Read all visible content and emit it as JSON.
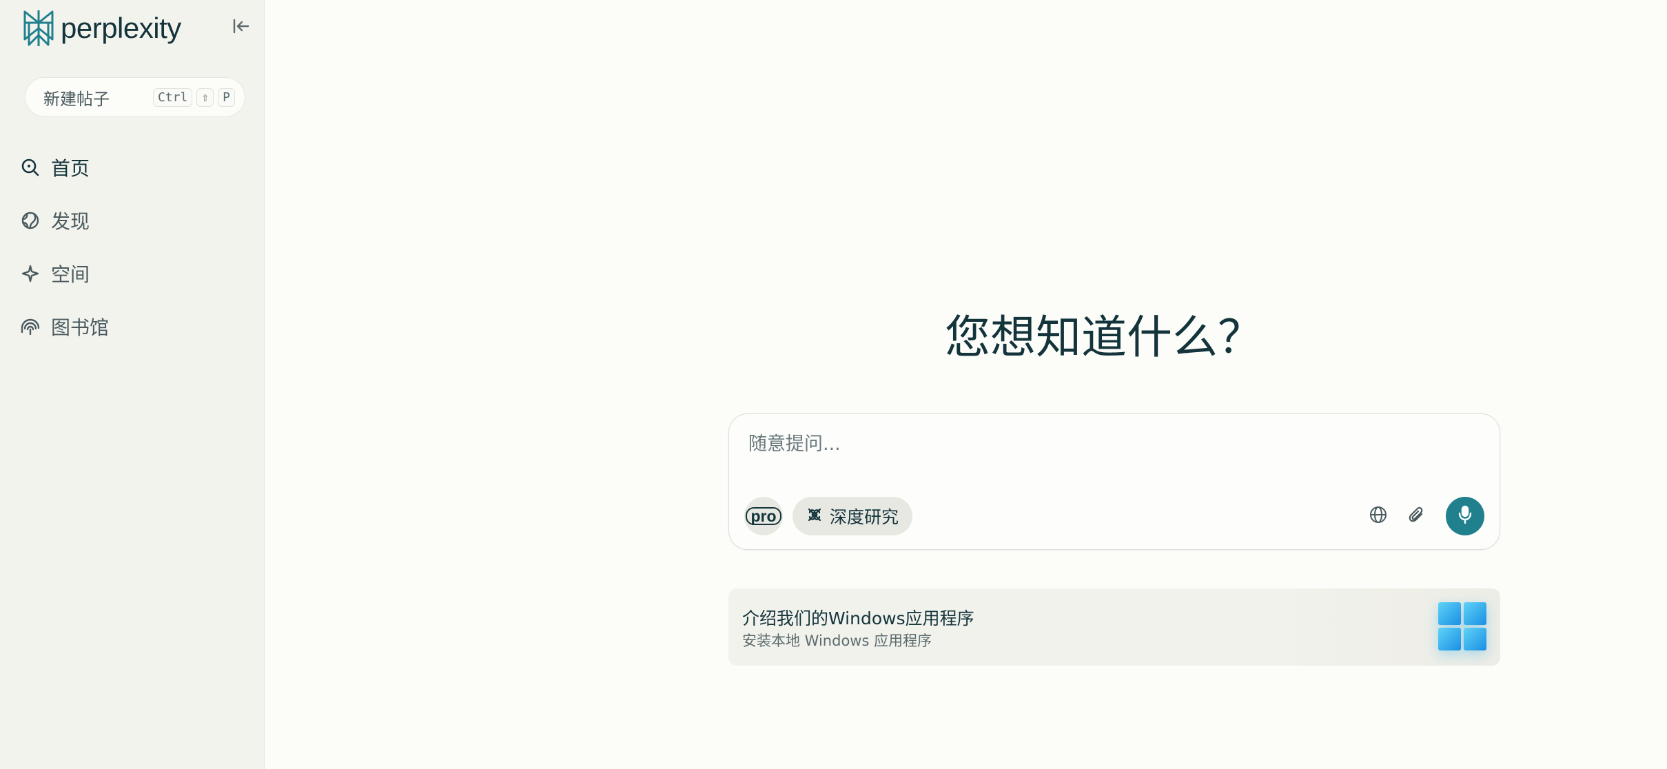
{
  "brand": {
    "name": "perplexity",
    "accent": "#20808d",
    "ink": "#13343b"
  },
  "sidebar": {
    "new_thread": {
      "label": "新建帖子",
      "shortcut": [
        "Ctrl",
        "⇧",
        "P"
      ]
    },
    "items": [
      {
        "label": "首页",
        "icon": "search-icon"
      },
      {
        "label": "发现",
        "icon": "globe-discover-icon"
      },
      {
        "label": "空间",
        "icon": "sparkle-icon"
      },
      {
        "label": "图书馆",
        "icon": "library-icon"
      }
    ]
  },
  "main": {
    "headline": "您想知道什么？",
    "composer": {
      "placeholder": "随意提问...",
      "value": "",
      "pro_label": "pro",
      "deep_research_label": "深度研究"
    },
    "promo": {
      "title": "介绍我们的Windows应用程序",
      "subtitle": "安装本地 Windows 应用程序"
    }
  }
}
